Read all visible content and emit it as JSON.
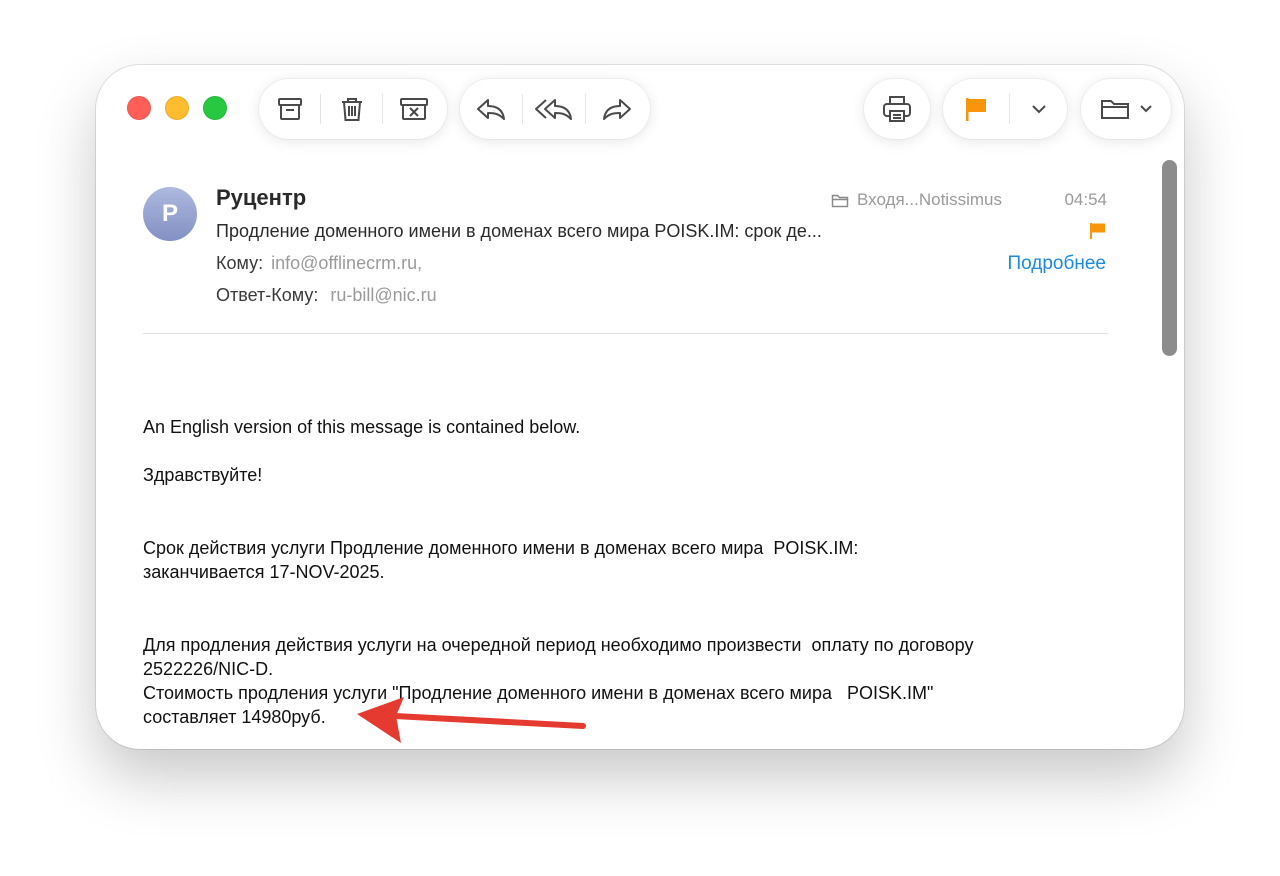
{
  "toolbar": {
    "archive_icon": "archive-icon",
    "delete_icon": "trash-icon",
    "junk_icon": "junk-icon",
    "reply_icon": "reply-icon",
    "reply_all_icon": "reply-all-icon",
    "forward_icon": "forward-icon",
    "print_icon": "printer-icon",
    "flag_icon": "flag-icon",
    "flag_color": "#f7960a",
    "move_icon": "folder-icon"
  },
  "message": {
    "avatar_initial": "Р",
    "sender": "Руцентр",
    "folder": "Входя...Notissimus",
    "time": "04:54",
    "subject": "Продление доменного имени в доменах всего мира  POISK.IM: срок де...",
    "to_label": "Кому:",
    "to_value": "info@offlinecrm.ru,",
    "reply_to_label": "Ответ-Кому:",
    "reply_to_value": "ru-bill@nic.ru",
    "details_link": "Подробнее",
    "link_color": "#1a8be0"
  },
  "body": {
    "line1": "An English version of this message is contained below.",
    "line2": "Здравствуйте!",
    "line3": "Срок действия услуги Продление доменного имени в доменах всего мира  POISK.IM:\nзаканчивается 17-NOV-2025.",
    "line4": "Для продления действия услуги на очередной период необходимо произвести  оплату по договору\n2522226/NIC-D.",
    "line5": "Стоимость продления услуги \"Продление доменного имени в доменах всего мира   POISK.IM\"\nсоставляет 14980руб."
  },
  "annotation": {
    "arrow_color": "#e53a2f"
  }
}
